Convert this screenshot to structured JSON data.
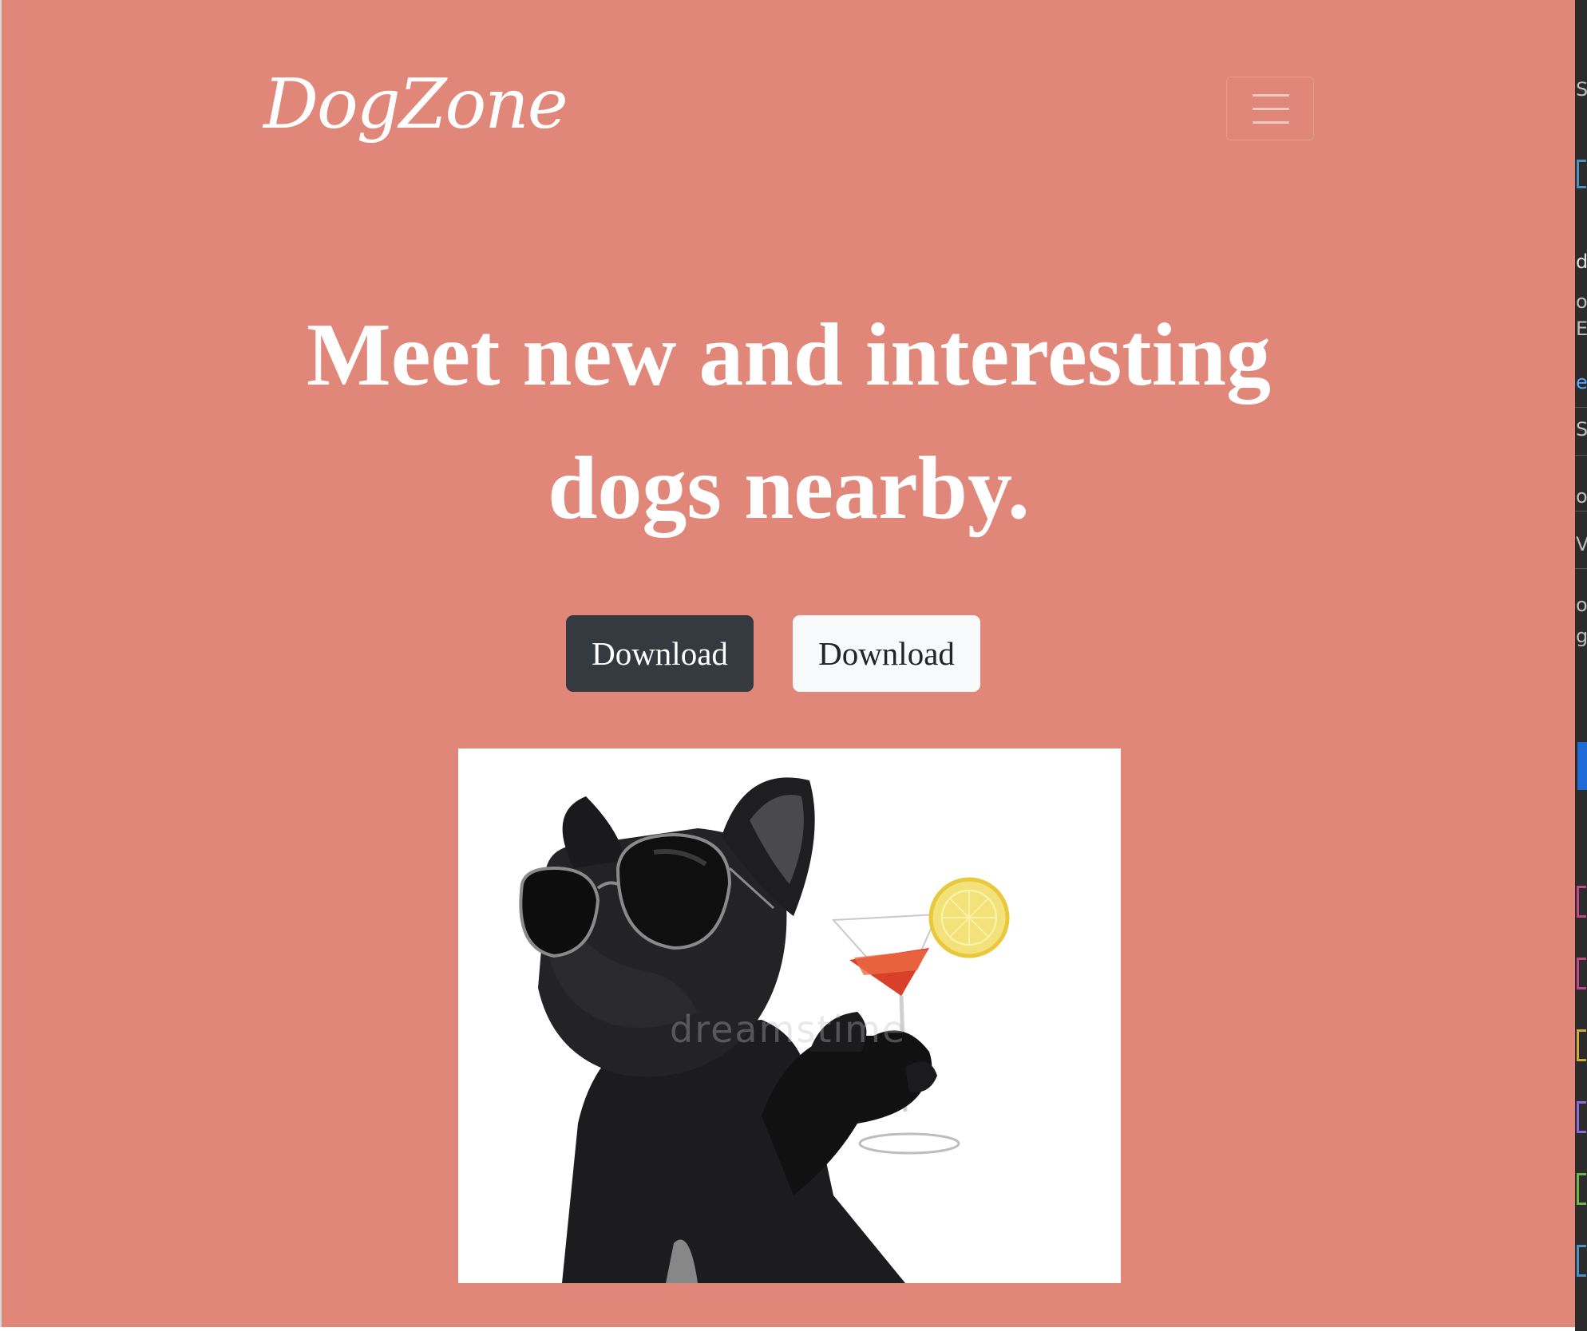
{
  "navbar": {
    "brand": "DogZone",
    "toggler_icon": "hamburger-menu-icon"
  },
  "hero": {
    "title_line1": "Meet new and interesting",
    "title_line2": "dogs nearby."
  },
  "buttons": {
    "primary_label": "Download",
    "secondary_label": "Download"
  },
  "image": {
    "alt": "French bulldog wearing sunglasses holding a cocktail",
    "watermark": "dreamstime"
  },
  "colors": {
    "background": "#e0877a",
    "primary_button": "#343a40",
    "secondary_button": "#f8f9fa",
    "text_light": "#ffffff"
  },
  "devtools": {
    "fragments": [
      "S",
      "d",
      "o",
      "E",
      "el",
      "S",
      "o",
      "V",
      "o",
      "g"
    ]
  }
}
